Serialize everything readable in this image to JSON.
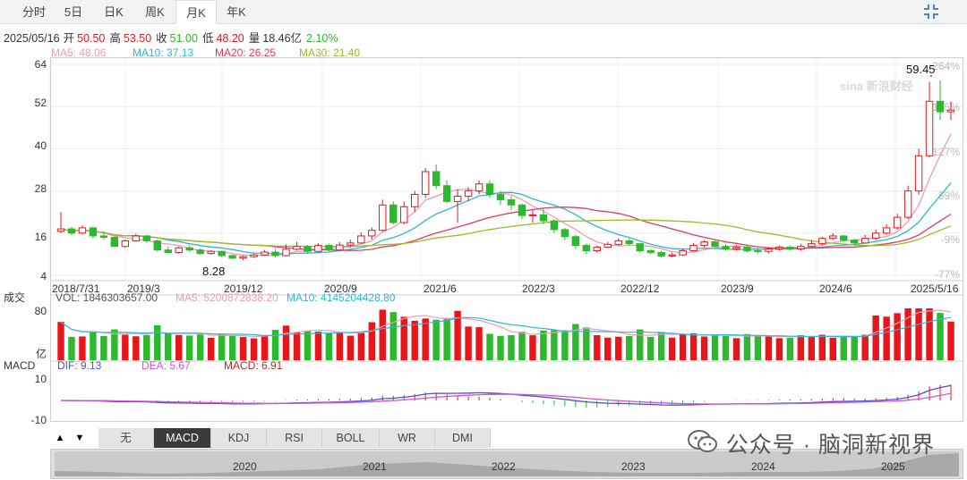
{
  "tabs": [
    "分时",
    "5日",
    "日K",
    "周K",
    "月K",
    "年K"
  ],
  "active_tab": "月K",
  "info": {
    "date": "2025/05/16",
    "open_label": "开",
    "open": "50.50",
    "high_label": "高",
    "high": "53.50",
    "close_label": "收",
    "close": "51.00",
    "low_label": "低",
    "low": "48.20",
    "volume_label": "量",
    "volume": "18.46亿",
    "change": "2.10%"
  },
  "ma": {
    "ma5": "MA5: 48.06",
    "ma10": "MA10: 37.13",
    "ma20": "MA20: 26.25",
    "ma30": "MA30: 21.40"
  },
  "volume_panel": {
    "title": "成交",
    "vol": "VOL: 1846303657.00",
    "ma5": "MA5: 5200872838.20",
    "ma10": "MA10: 4145204428.80",
    "tick_top": "80",
    "unit": "亿"
  },
  "macd_panel": {
    "title": "MACD",
    "dif": "DIF: 9.13",
    "dea": "DEA: 5.67",
    "macd": "MACD: 6.91",
    "tick_top": "10",
    "tick_bottom": "-10"
  },
  "price_axis": [
    "64",
    "52",
    "40",
    "28",
    "16",
    "4"
  ],
  "pct_axis": [
    "264%",
    "195%",
    "127%",
    "59%",
    "-9%",
    "-77%"
  ],
  "date_axis": [
    "2018/7/31",
    "2019/3",
    "2019/12",
    "2020/9",
    "2021/6",
    "2022/3",
    "2022/12",
    "2023/9",
    "2024/6",
    "2025/5/16"
  ],
  "annotations": {
    "high": "59.45",
    "low": "8.28"
  },
  "logo_text": "sina 新浪财经",
  "indicator_tabs": [
    "无",
    "MACD",
    "KDJ",
    "RSI",
    "BOLL",
    "WR",
    "DMI"
  ],
  "active_indicator": "MACD",
  "nav_arrows": [
    "▲",
    "▼"
  ],
  "scroll_years": [
    "2020",
    "2021",
    "2022",
    "2023",
    "2024",
    "2025"
  ],
  "watermark": "公众号 · 脑洞新视界",
  "colors": {
    "up": "#e8161b",
    "down": "#2db82d",
    "ma5": "#f39bb0",
    "ma10": "#2fb6d6",
    "ma20": "#e03a5e",
    "ma30": "#9cbc2a",
    "dif": "#4e4ed8",
    "dea": "#d84fd8"
  },
  "chart_data": {
    "type": "candlestick",
    "y_range": [
      4,
      64
    ],
    "x_range": [
      "2018/7",
      "2025/5"
    ],
    "series": [
      {
        "name": "MA5",
        "values": []
      },
      {
        "name": "MA10",
        "values": []
      },
      {
        "name": "MA20",
        "values": []
      },
      {
        "name": "MA30",
        "values": []
      }
    ],
    "candles": [
      [
        "2018/7",
        16.5,
        17.2,
        22,
        16
      ],
      [
        "2018/8",
        17.2,
        16,
        17.8,
        15.5
      ],
      [
        "2018/9",
        16,
        17.5,
        18.2,
        15.6
      ],
      [
        "2018/10",
        17.5,
        15.2,
        17.8,
        14.5
      ],
      [
        "2018/11",
        15.2,
        14.8,
        16.5,
        14.2
      ],
      [
        "2018/12",
        14.8,
        12.2,
        15,
        12
      ],
      [
        "2019/1",
        12.2,
        13.8,
        14.2,
        11.8
      ],
      [
        "2019/2",
        13.8,
        15.2,
        15.8,
        13.5
      ],
      [
        "2019/3",
        15.2,
        13.8,
        15.5,
        13.2
      ],
      [
        "2019/4",
        13.8,
        11.2,
        14.2,
        10.8
      ],
      [
        "2019/5",
        11.2,
        10.5,
        12.2,
        10.2
      ],
      [
        "2019/6",
        10.5,
        11.8,
        12.2,
        10.2
      ],
      [
        "2019/7",
        11.8,
        11.2,
        12.6,
        10.8
      ],
      [
        "2019/8",
        11.2,
        10.2,
        11.6,
        9.8
      ],
      [
        "2019/9",
        10.2,
        10.8,
        11.2,
        9.8
      ],
      [
        "2019/10",
        10.8,
        9.6,
        11,
        9.2
      ],
      [
        "2019/11",
        9.6,
        8.9,
        9.9,
        8.5
      ],
      [
        "2019/12",
        8.9,
        9.3,
        9.6,
        8.28
      ],
      [
        "2020/1",
        9.3,
        9.8,
        10.2,
        9
      ],
      [
        "2020/2",
        9.8,
        10.6,
        11.2,
        9.5
      ],
      [
        "2020/3",
        10.6,
        9.6,
        11.5,
        9.2
      ],
      [
        "2020/4",
        9.6,
        11.4,
        12.8,
        9.4
      ],
      [
        "2020/5",
        11.4,
        12.2,
        13.5,
        11
      ],
      [
        "2020/6",
        12.2,
        10.8,
        12.6,
        10.2
      ],
      [
        "2020/7",
        10.8,
        12.5,
        13.2,
        10.5
      ],
      [
        "2020/8",
        12.5,
        11.2,
        13,
        10.8
      ],
      [
        "2020/9",
        11.2,
        12.6,
        13.4,
        10.8
      ],
      [
        "2020/10",
        12.6,
        13.2,
        14.1,
        12
      ],
      [
        "2020/11",
        13.2,
        15.2,
        16.2,
        13
      ],
      [
        "2020/12",
        15.2,
        16.8,
        17.6,
        14.2
      ],
      [
        "2021/1",
        16.8,
        24,
        25.5,
        16.5
      ],
      [
        "2021/2",
        24,
        19,
        25,
        18.5
      ],
      [
        "2021/3",
        19,
        23.5,
        25,
        18.5
      ],
      [
        "2021/4",
        23.5,
        27,
        28,
        22
      ],
      [
        "2021/5",
        27,
        33.5,
        34.5,
        26
      ],
      [
        "2021/6",
        33.5,
        29.5,
        35.5,
        28.5
      ],
      [
        "2021/7",
        29.5,
        25,
        31,
        24.5
      ],
      [
        "2021/8",
        25,
        26.5,
        28.5,
        19
      ],
      [
        "2021/9",
        26.5,
        28,
        29,
        25
      ],
      [
        "2021/10",
        28,
        30,
        31,
        27
      ],
      [
        "2021/11",
        30,
        27,
        31,
        26
      ],
      [
        "2021/12",
        27,
        25.5,
        28,
        24
      ],
      [
        "2022/1",
        25.5,
        24,
        26.5,
        22.5
      ],
      [
        "2022/2",
        24,
        21,
        24.5,
        20
      ],
      [
        "2022/3",
        21,
        21.2,
        22.5,
        19
      ],
      [
        "2022/4",
        21.2,
        19.5,
        23,
        18.5
      ],
      [
        "2022/5",
        19.5,
        17,
        20,
        16
      ],
      [
        "2022/6",
        17,
        15,
        17.5,
        14
      ],
      [
        "2022/7",
        15,
        12.5,
        15.5,
        11.5
      ],
      [
        "2022/8",
        12.5,
        11,
        13,
        10
      ],
      [
        "2022/9",
        11,
        12,
        12.5,
        10.5
      ],
      [
        "2022/10",
        12,
        12.8,
        13.5,
        11.8
      ],
      [
        "2022/11",
        12.8,
        13.8,
        14.5,
        12.5
      ],
      [
        "2022/12",
        13.8,
        13,
        14.5,
        12.5
      ],
      [
        "2023/1",
        13,
        11,
        13.2,
        10.5
      ],
      [
        "2023/2",
        11,
        10.5,
        11.5,
        10
      ],
      [
        "2023/3",
        10.5,
        9.5,
        11,
        9
      ],
      [
        "2023/4",
        9.5,
        9.8,
        10.5,
        9.2
      ],
      [
        "2023/5",
        9.8,
        11,
        11.5,
        9.5
      ],
      [
        "2023/6",
        11,
        12.5,
        13.2,
        10.8
      ],
      [
        "2023/7",
        12.5,
        13.5,
        14,
        12
      ],
      [
        "2023/8",
        13.5,
        12.2,
        14,
        12
      ],
      [
        "2023/9",
        12.2,
        11.5,
        12.8,
        11
      ],
      [
        "2023/10",
        11.5,
        12,
        12.5,
        11
      ],
      [
        "2023/11",
        12,
        11,
        12.5,
        10.5
      ],
      [
        "2023/12",
        11,
        10.8,
        11.8,
        10.2
      ],
      [
        "2024/1",
        10.8,
        11.5,
        12,
        10.2
      ],
      [
        "2024/2",
        11.5,
        12,
        12.5,
        11
      ],
      [
        "2024/3",
        12,
        11.5,
        12.5,
        11
      ],
      [
        "2024/4",
        11.5,
        12.2,
        13,
        11
      ],
      [
        "2024/5",
        12.2,
        13,
        14,
        12
      ],
      [
        "2024/6",
        13,
        14.5,
        15,
        12.5
      ],
      [
        "2024/7",
        14.5,
        15.2,
        16,
        14
      ],
      [
        "2024/8",
        15.2,
        14,
        15.5,
        13.5
      ],
      [
        "2024/9",
        14,
        13.2,
        14.5,
        12.5
      ],
      [
        "2024/10",
        13.2,
        14.5,
        15.5,
        13
      ],
      [
        "2024/11",
        14.5,
        16,
        17,
        14
      ],
      [
        "2024/12",
        16,
        17.5,
        18.5,
        15.5
      ],
      [
        "2025/1",
        17.5,
        20.5,
        21.5,
        17
      ],
      [
        "2025/2",
        20.5,
        28,
        29.5,
        20
      ],
      [
        "2025/3",
        28,
        38,
        40,
        27
      ],
      [
        "2025/4",
        38,
        53.5,
        59,
        37.5
      ],
      [
        "2025/5",
        53.5,
        50.5,
        59.45,
        48.2
      ],
      [
        "2025/6",
        50.5,
        51,
        53.5,
        48.2
      ]
    ],
    "macd": {
      "dif": 9.13,
      "dea": 5.67,
      "macd": 6.91
    }
  }
}
